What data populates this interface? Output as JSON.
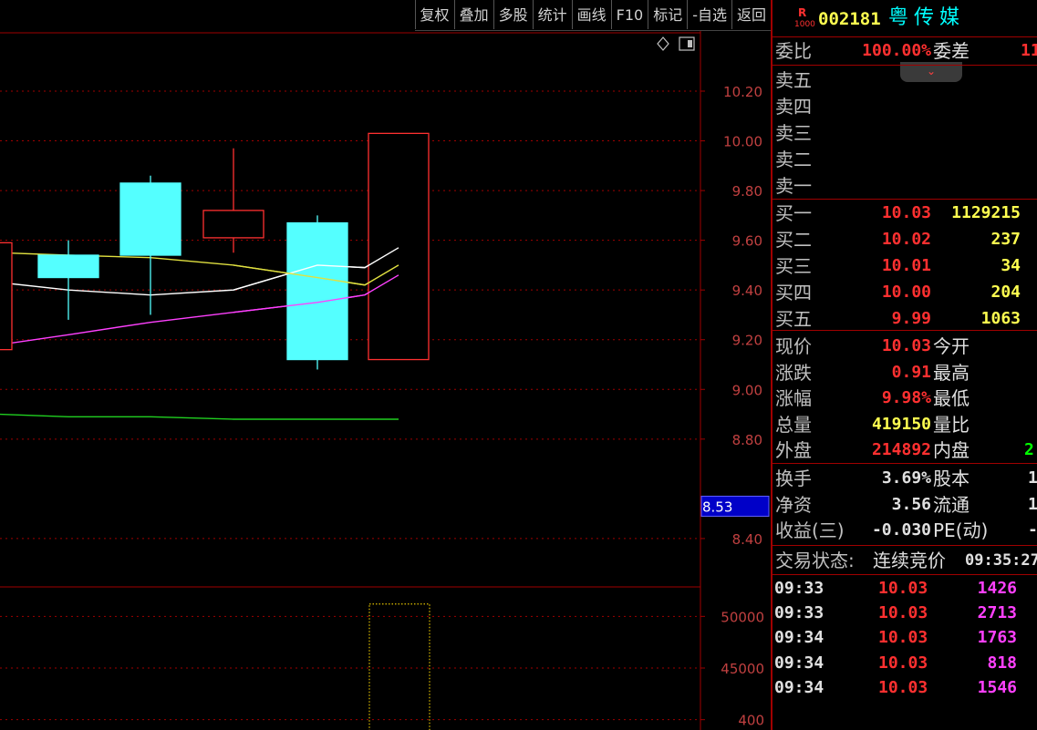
{
  "toolbar": {
    "items": [
      "复权",
      "叠加",
      "多股",
      "统计",
      "画线",
      "F10",
      "标记",
      "-自选",
      "返回"
    ]
  },
  "chart_data": [
    {
      "type": "candlestick",
      "title": "",
      "y_ticks": [
        10.2,
        10.0,
        9.8,
        9.6,
        9.4,
        9.2,
        9.0,
        8.8,
        8.4
      ],
      "y_ticks_text": [
        "10.20",
        "10.00",
        "9.80",
        "9.60",
        "9.40",
        "9.20",
        "9.00",
        "8.80",
        "8.40"
      ],
      "ylim": [
        8.22,
        10.42
      ],
      "candles": [
        {
          "open": 9.16,
          "close": 9.59,
          "high": 9.6,
          "low": 9.16,
          "color": "#ff3030",
          "hollow": true,
          "partial": true
        },
        {
          "open": 9.54,
          "close": 9.45,
          "high": 9.6,
          "low": 9.28,
          "color": "#54ffff",
          "hollow": false
        },
        {
          "open": 9.83,
          "close": 9.54,
          "high": 9.86,
          "low": 9.3,
          "color": "#54ffff",
          "hollow": false
        },
        {
          "open": 9.61,
          "close": 9.72,
          "high": 9.97,
          "low": 9.55,
          "color": "#ff3030",
          "hollow": true
        },
        {
          "open": 9.67,
          "close": 9.12,
          "high": 9.7,
          "low": 9.08,
          "color": "#54ffff",
          "hollow": false
        },
        {
          "open": 9.12,
          "close": 10.03,
          "high": 10.03,
          "low": 9.12,
          "color": "#ff3030",
          "hollow": true
        }
      ],
      "ma_lines": [
        {
          "color": "#ffffff",
          "values": [
            9.43,
            9.4,
            9.38,
            9.4,
            9.5,
            9.49,
            9.57
          ]
        },
        {
          "color": "#e0e040",
          "values": [
            9.55,
            9.54,
            9.53,
            9.5,
            9.45,
            9.42,
            9.5
          ]
        },
        {
          "color": "#ff40ff",
          "values": [
            9.18,
            9.22,
            9.27,
            9.31,
            9.35,
            9.38,
            9.46
          ]
        },
        {
          "color": "#20d020",
          "values": [
            8.9,
            8.89,
            8.89,
            8.88,
            8.88,
            8.88,
            8.88
          ]
        }
      ],
      "marker_value": "8.53"
    },
    {
      "type": "bar",
      "title": "",
      "y_ticks": [
        50000,
        45000,
        40000
      ],
      "y_ticks_text": [
        "50000",
        "45000",
        "400"
      ],
      "ylim": [
        39000,
        52500
      ],
      "bars": [
        {
          "value": 51200,
          "color": "#e0c000",
          "style": "dotted"
        }
      ]
    }
  ],
  "quote": {
    "r_label": "R",
    "r_sub": "1000",
    "code": "002181",
    "name": "粤传媒",
    "weibi_label": "委比",
    "weibi_value": "100.00%",
    "weicha_label": "委差",
    "weicha_value": "11",
    "sell": [
      {
        "label": "卖五"
      },
      {
        "label": "卖四"
      },
      {
        "label": "卖三"
      },
      {
        "label": "卖二"
      },
      {
        "label": "卖一"
      }
    ],
    "buy": [
      {
        "label": "买一",
        "price": "10.03",
        "vol": "1129215"
      },
      {
        "label": "买二",
        "price": "10.02",
        "vol": "237"
      },
      {
        "label": "买三",
        "price": "10.01",
        "vol": "34"
      },
      {
        "label": "买四",
        "price": "10.00",
        "vol": "204"
      },
      {
        "label": "买五",
        "price": "9.99",
        "vol": "1063"
      }
    ],
    "stats1": [
      {
        "label": "现价",
        "value": "10.03",
        "color": "red",
        "label2": "今开",
        "value2": ""
      },
      {
        "label": "涨跌",
        "value": "0.91",
        "color": "red",
        "label2": "最高",
        "value2": ""
      },
      {
        "label": "涨幅",
        "value": "9.98%",
        "color": "red",
        "label2": "最低",
        "value2": ""
      },
      {
        "label": "总量",
        "value": "419150",
        "color": "yel",
        "label2": "量比",
        "value2": ""
      },
      {
        "label": "外盘",
        "value": "214892",
        "color": "red",
        "label2": "内盘",
        "value2": "2("
      }
    ],
    "stats2": [
      {
        "label": "换手",
        "value": "3.69%",
        "label2": "股本",
        "value2": "1"
      },
      {
        "label": "净资",
        "value": "3.56",
        "label2": "流通",
        "value2": "1"
      },
      {
        "label": "收益(三)",
        "value": "-0.030",
        "label2": "PE(动)",
        "value2": "-"
      }
    ],
    "status_label": "交易状态:",
    "status_value": "连续竞价",
    "status_time": "09:35:27",
    "ticks": [
      {
        "time": "09:33",
        "price": "10.03",
        "vol": "1426"
      },
      {
        "time": "09:33",
        "price": "10.03",
        "vol": "2713"
      },
      {
        "time": "09:34",
        "price": "10.03",
        "vol": "1763"
      },
      {
        "time": "09:34",
        "price": "10.03",
        "vol": "818"
      },
      {
        "time": "09:34",
        "price": "10.03",
        "vol": "1546"
      }
    ]
  }
}
